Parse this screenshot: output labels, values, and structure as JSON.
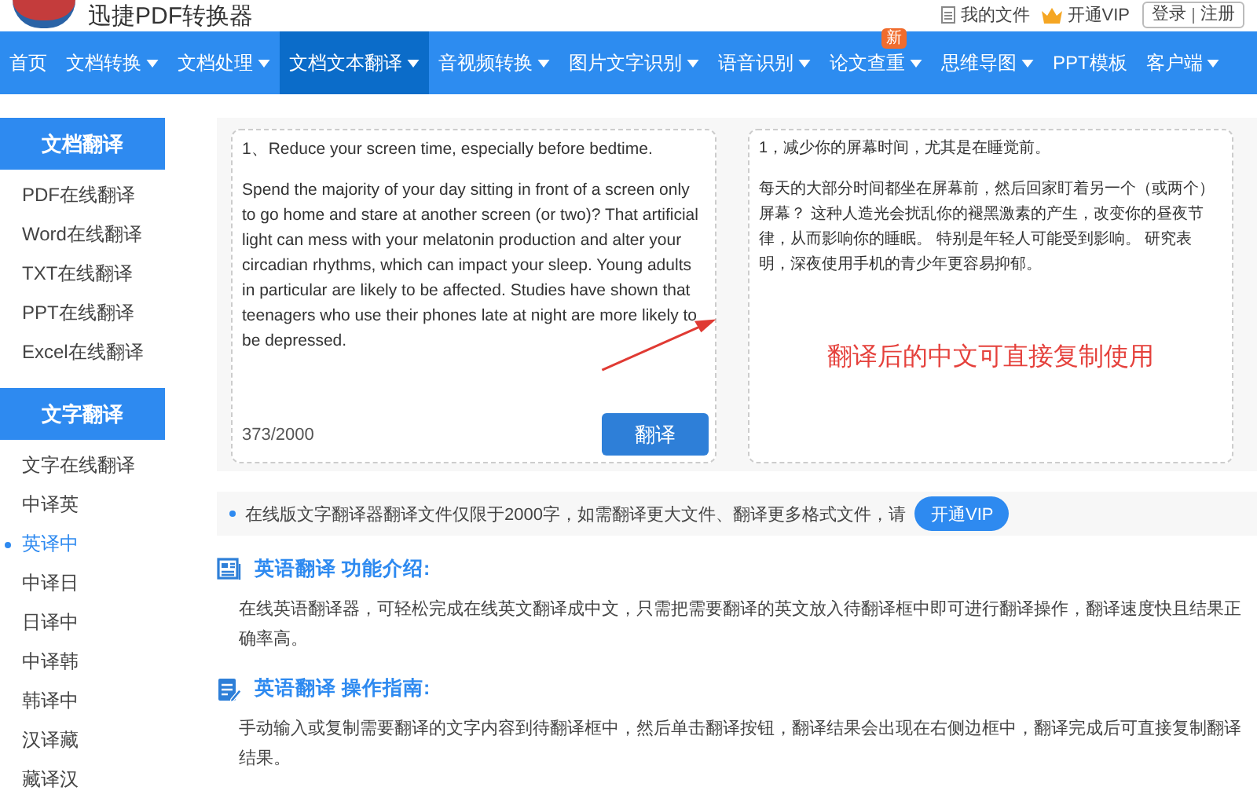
{
  "header": {
    "logo_text": "迅捷PDF转换器",
    "links": [
      "我的文件",
      "开通VIP"
    ],
    "login": "登录",
    "register": "注册"
  },
  "nav": [
    {
      "label": "首页",
      "selected": false,
      "has_menu": false
    },
    {
      "label": "文档转换",
      "selected": false,
      "has_menu": true
    },
    {
      "label": "文档处理",
      "selected": false,
      "has_menu": true
    },
    {
      "label": "文档文本翻译",
      "selected": true,
      "has_menu": true
    },
    {
      "label": "音视频转换",
      "selected": false,
      "has_menu": true
    },
    {
      "label": "图片文字识别",
      "selected": false,
      "has_menu": true
    },
    {
      "label": "语音识别",
      "selected": false,
      "has_menu": true
    },
    {
      "label": "论文查重",
      "selected": false,
      "has_menu": true,
      "badge": "新"
    },
    {
      "label": "思维导图",
      "selected": false,
      "has_menu": true
    },
    {
      "label": "PPT模板",
      "selected": false,
      "has_menu": false
    },
    {
      "label": "客户端",
      "selected": false,
      "has_menu": true
    }
  ],
  "sidebar": [
    {
      "title": "文档翻译",
      "items": [
        {
          "label": "PDF在线翻译",
          "selected": false
        },
        {
          "label": "Word在线翻译",
          "selected": false
        },
        {
          "label": "TXT在线翻译",
          "selected": false
        },
        {
          "label": "PPT在线翻译",
          "selected": false
        },
        {
          "label": "Excel在线翻译",
          "selected": false
        }
      ]
    },
    {
      "title": "文字翻译",
      "items": [
        {
          "label": "文字在线翻译",
          "selected": false
        },
        {
          "label": "中译英",
          "selected": false
        },
        {
          "label": "英译中",
          "selected": true
        },
        {
          "label": "中译日",
          "selected": false
        },
        {
          "label": "日译中",
          "selected": false
        },
        {
          "label": "中译韩",
          "selected": false
        },
        {
          "label": "韩译中",
          "selected": false
        },
        {
          "label": "汉译藏",
          "selected": false
        },
        {
          "label": "藏译汉",
          "selected": false
        }
      ]
    }
  ],
  "source": {
    "paragraphs": [
      "1、Reduce your screen time, especially before bedtime.",
      "Spend the majority of your day sitting in front of a screen only to go home and stare at another screen (or two)? That artificial light can mess with your melatonin production and alter your circadian rhythms, which can impact your sleep. Young adults in particular are likely to be affected. Studies have shown that teenagers who use their phones late at night are more likely to be depressed."
    ],
    "count": "373/2000",
    "button": "翻译"
  },
  "result": {
    "paragraphs": [
      "1，减少你的屏幕时间，尤其是在睡觉前。",
      "每天的大部分时间都坐在屏幕前，然后回家盯着另一个（或两个）屏幕？ 这种人造光会扰乱你的褪黑激素的产生，改变你的昼夜节律，从而影响你的睡眠。 特别是年轻人可能受到影响。 研究表明，深夜使用手机的青少年更容易抑郁。"
    ],
    "annotation": "翻译后的中文可直接复制使用"
  },
  "notice": {
    "text": "在线版文字翻译器翻译文件仅限于2000字，如需翻译更大文件、翻译更多格式文件，请",
    "button": "开通VIP"
  },
  "sections": [
    {
      "kind": "intro",
      "title": "英语翻译 功能介绍:",
      "body": "在线英语翻译器，可轻松完成在线英文翻译成中文，只需把需要翻译的英文放入待翻译框中即可进行翻译操作，翻译速度快且结果正确率高。"
    },
    {
      "kind": "guide",
      "title": "英语翻译 操作指南:",
      "body": "手动输入或复制需要翻译的文字内容到待翻译框中，然后单击翻译按钮，翻译结果会出现在右侧边框中，翻译完成后可直接复制翻译结果。"
    }
  ]
}
